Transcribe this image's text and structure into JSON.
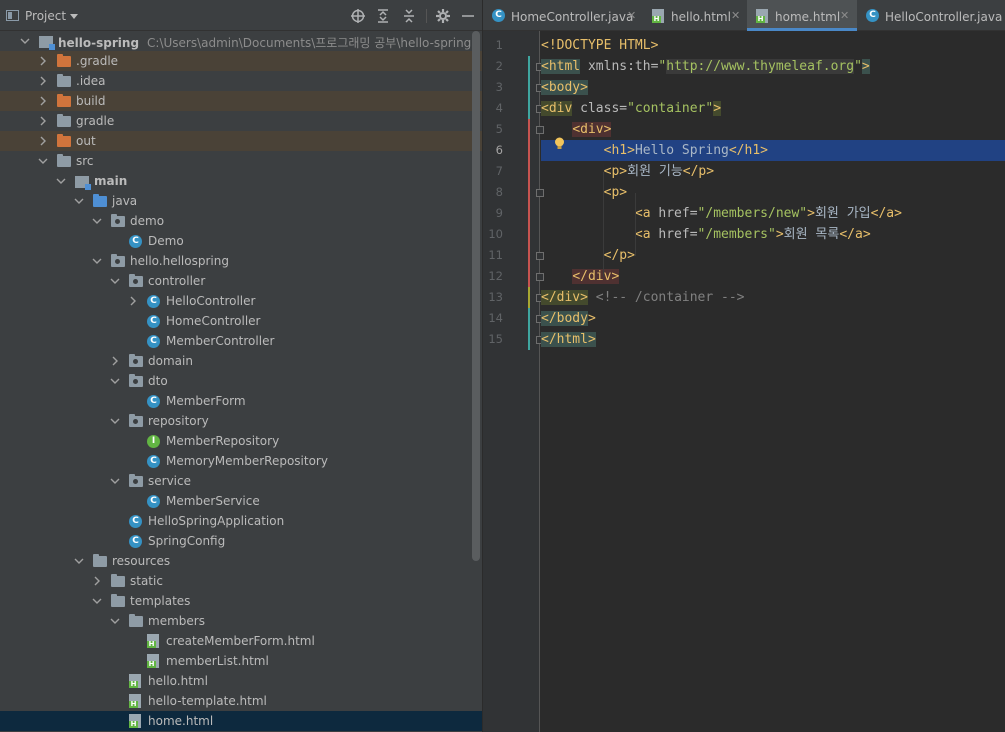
{
  "project_panel": {
    "title": "Project",
    "toolbar": [
      "locate-icon",
      "expand-all-icon",
      "collapse-all-icon",
      "settings-icon",
      "hide-icon"
    ]
  },
  "tree": {
    "root": {
      "name": "hello-spring",
      "path": "C:\\Users\\admin\\Documents\\프로그래밍 공부\\hello-spring"
    },
    "items": [
      "hello-spring",
      ".gradle",
      ".idea",
      "build",
      "gradle",
      "out",
      "src",
      "main",
      "java",
      "demo",
      "Demo",
      "hello.hellospring",
      "controller",
      "HelloController",
      "HomeController",
      "MemberController",
      "domain",
      "dto",
      "MemberForm",
      "repository",
      "MemberRepository",
      "MemoryMemberRepository",
      "service",
      "MemberService",
      "HelloSpringApplication",
      "SpringConfig",
      "resources",
      "static",
      "templates",
      "members",
      "createMemberForm.html",
      "memberList.html",
      "hello.html",
      "hello-template.html",
      "home.html"
    ]
  },
  "tabs": [
    "HomeController.java",
    "hello.html",
    "home.html",
    "HelloController.java"
  ],
  "active_tab": "home.html",
  "editor": {
    "line_numbers": [
      "1",
      "2",
      "3",
      "4",
      "5",
      "6",
      "7",
      "8",
      "9",
      "10",
      "11",
      "12",
      "13",
      "14",
      "15"
    ],
    "current_line": "6",
    "lines": [
      "<!DOCTYPE HTML>",
      "<html xmlns:th=\"http://www.thymeleaf.org\">",
      "<body>",
      "<div class=\"container\">",
      "    <div>",
      "        <h1>Hello Spring</h1>",
      "        <p>회원 기능</p>",
      "        <p>",
      "            <a href=\"/members/new\">회원 가입</a>",
      "            <a href=\"/members\">회원 목록</a>",
      "        </p>",
      "    </div>",
      "</div> <!-- /container -->",
      "</body>",
      "</html>"
    ]
  },
  "colors": {
    "tag": "#e8bf6a",
    "string": "#a5c261",
    "comment": "#808080",
    "selection": "#214283",
    "accent": "#4a88c7"
  }
}
